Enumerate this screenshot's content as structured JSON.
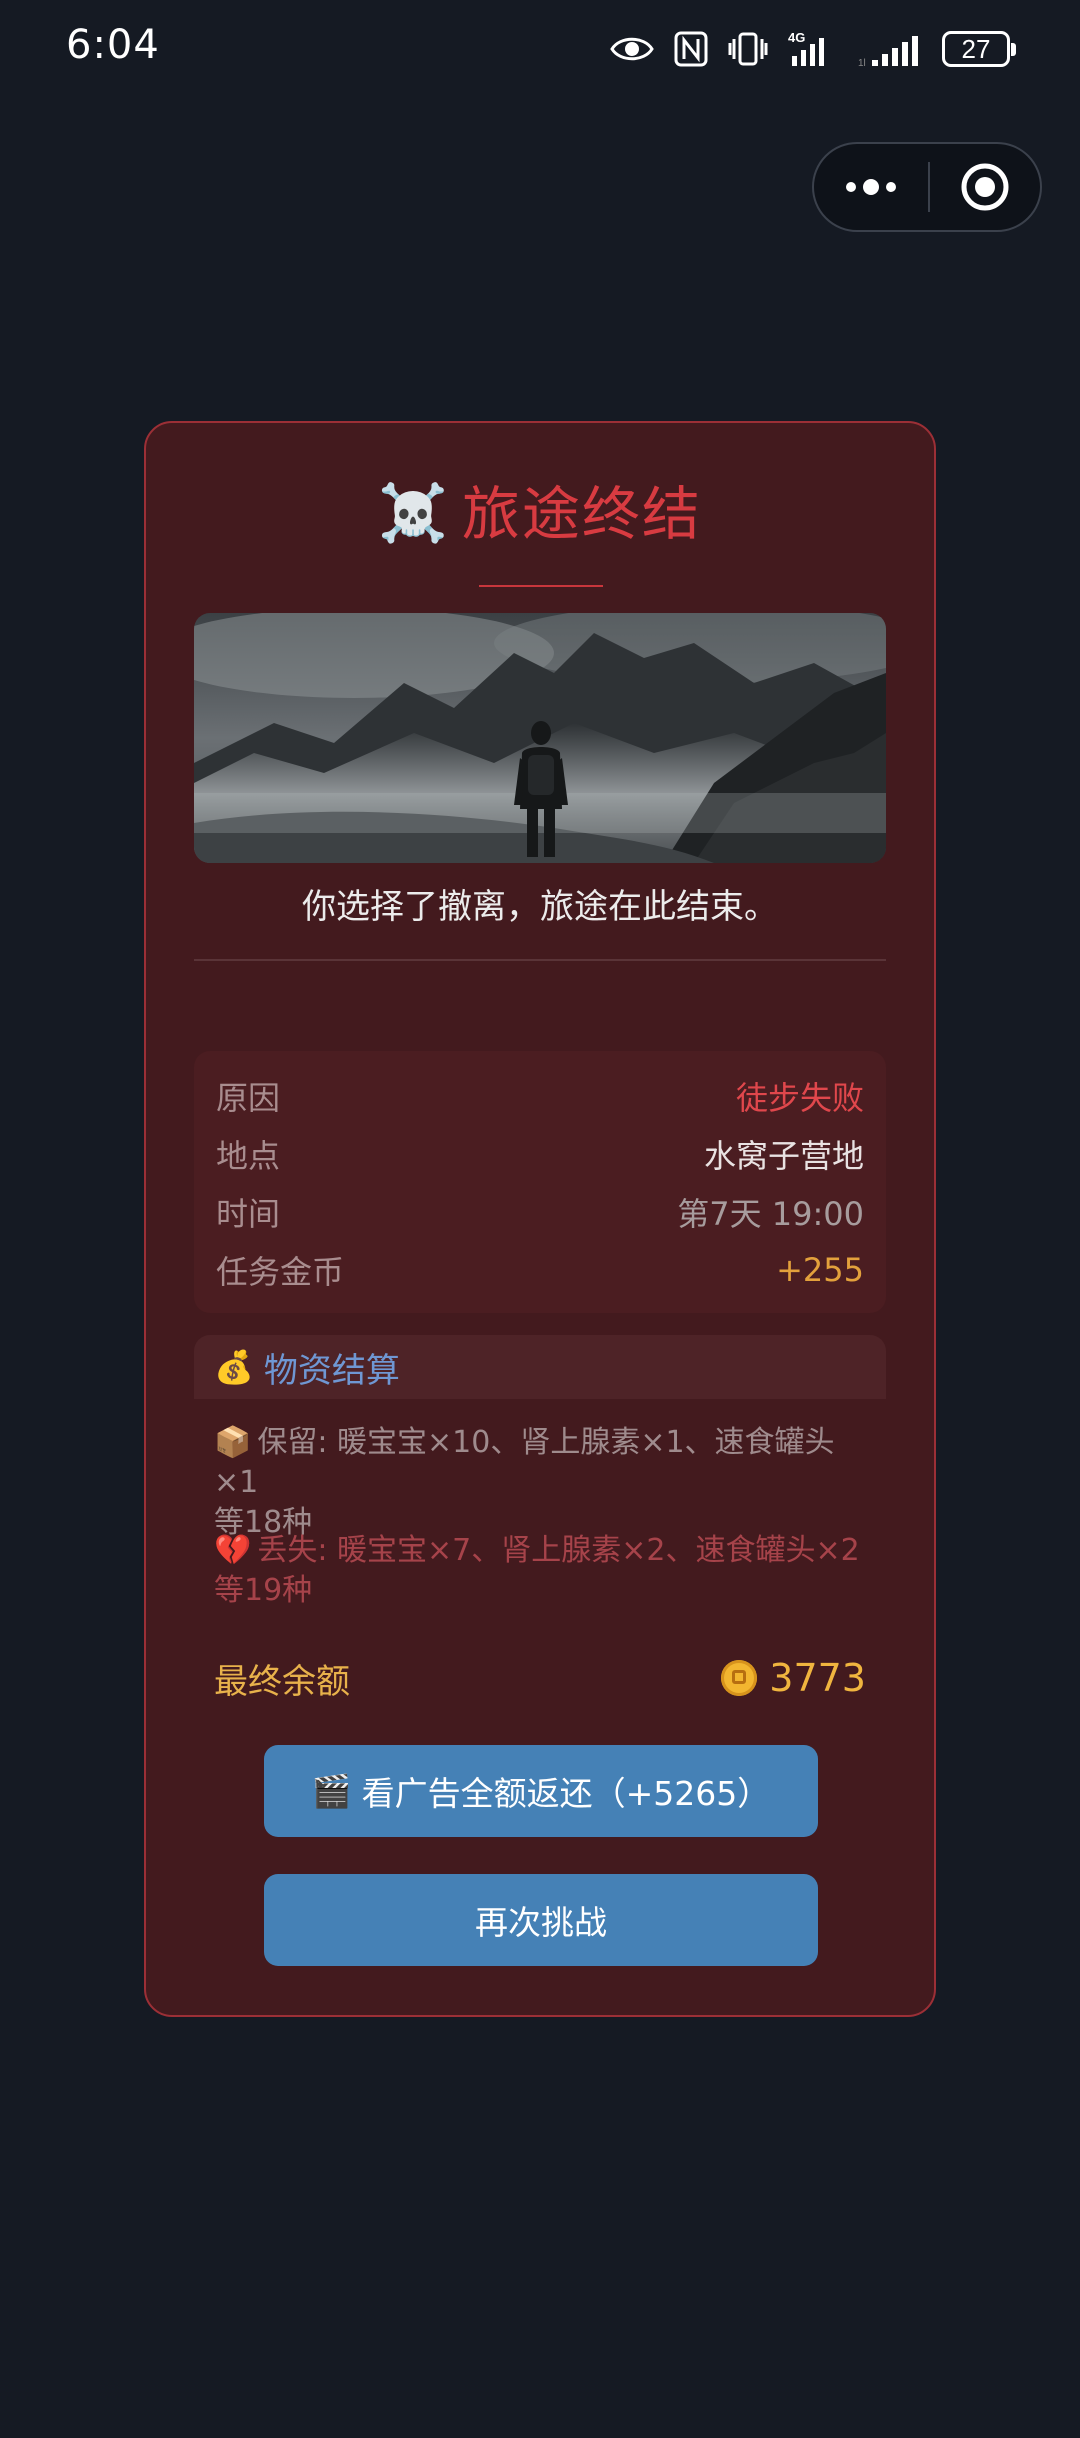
{
  "status_bar": {
    "time": "6:04",
    "icons": [
      "eye-icon",
      "nfc-icon",
      "vibrate-icon",
      "signal-4g-icon",
      "signal-icon"
    ],
    "battery": "27"
  },
  "capsule": {
    "more_icon": "more-dots-icon",
    "close_icon": "target-circle-icon"
  },
  "dialog": {
    "title_icon": "☠️",
    "title": "旅途终结",
    "image": "hiker-in-misty-mountains",
    "subtitle": "你选择了撤离，旅途在此结束。",
    "info": [
      {
        "label": "原因",
        "value": "徒步失败",
        "color": "#e0474c"
      },
      {
        "label": "地点",
        "value": "水窝子营地",
        "color": "#e9e2e2"
      },
      {
        "label": "时间",
        "value": "第7天 19:00",
        "color": "#a79c9d"
      },
      {
        "label": "任务金币",
        "value": "+255",
        "color": "#e3a13c"
      }
    ],
    "settlement": {
      "icon": "💰",
      "title": "物资结算",
      "keep_icon": "📦",
      "keep_text": "保留: 暖宝宝×10、肾上腺素×1、速食罐头×1",
      "keep_more": "等18种",
      "lost_icon": "💔",
      "lost_text": "丢失: 暖宝宝×7、肾上腺素×2、速食罐头×2",
      "lost_more": "等19种"
    },
    "final": {
      "label": "最终余额",
      "coin_icon": "coin-icon",
      "value": "3773"
    },
    "buttons": {
      "ad_icon": "🎬",
      "ad_label": "看广告全额返还（+5265）",
      "retry_label": "再次挑战"
    }
  },
  "colors": {
    "background": "#151a23",
    "card": "#431a1e",
    "card_border": "#9c2f36",
    "title": "#d83b41",
    "button": "#4581b6",
    "gold": "#f0b53f"
  }
}
